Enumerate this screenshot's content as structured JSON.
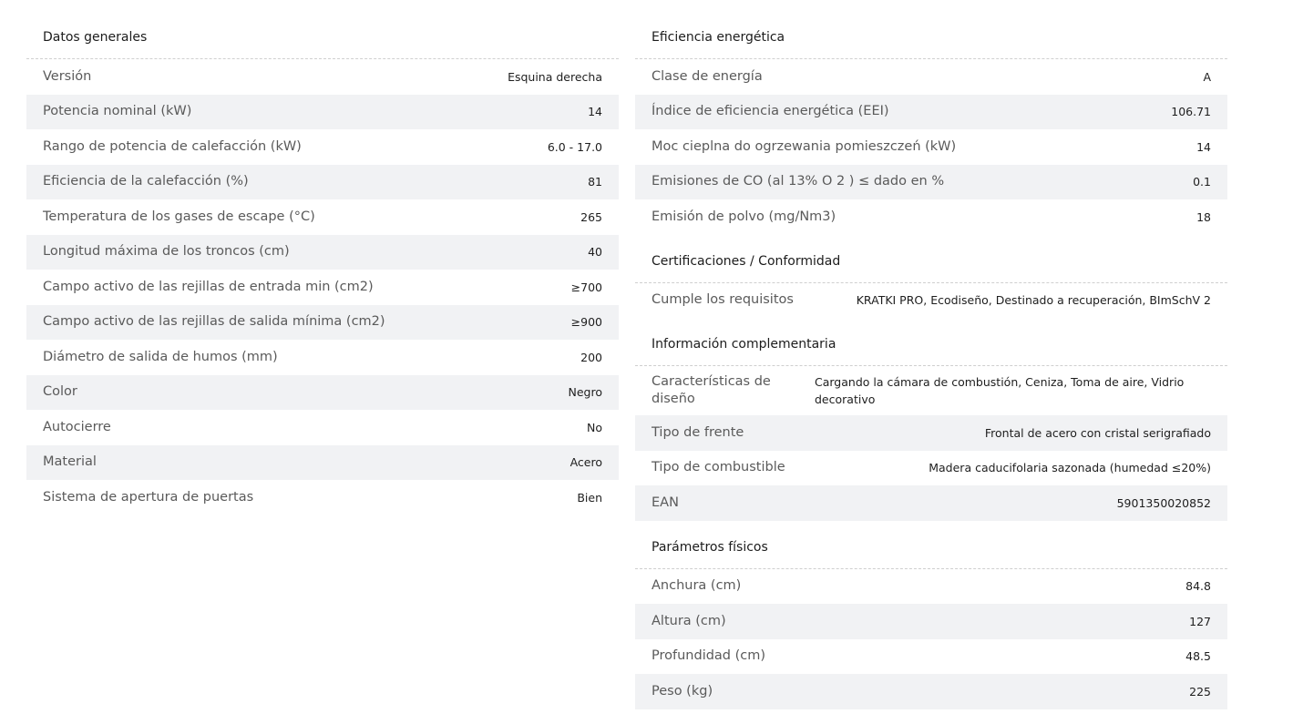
{
  "left": {
    "title": "Datos generales",
    "rows": [
      {
        "label": "Versión",
        "value": "Esquina derecha"
      },
      {
        "label": "Potencia nominal (kW)",
        "value": "14"
      },
      {
        "label": "Rango de potencia de calefacción (kW)",
        "value": "6.0 - 17.0"
      },
      {
        "label": "Eficiencia de la calefacción (%)",
        "value": "81"
      },
      {
        "label": "Temperatura de los gases de escape (°C)",
        "value": "265"
      },
      {
        "label": "Longitud máxima de los troncos (cm)",
        "value": "40"
      },
      {
        "label": "Campo activo de las rejillas de entrada min (cm2)",
        "value": "≥700"
      },
      {
        "label": "Campo activo de las rejillas de salida mínima (cm2)",
        "value": "≥900"
      },
      {
        "label": "Diámetro de salida de humos (mm)",
        "value": "200"
      },
      {
        "label": "Color",
        "value": "Negro"
      },
      {
        "label": "Autocierre",
        "value": "No"
      },
      {
        "label": "Material",
        "value": "Acero"
      },
      {
        "label": "Sistema de apertura de puertas",
        "value": "Bien"
      }
    ]
  },
  "energy": {
    "title": "Eficiencia energética",
    "rows": [
      {
        "label": "Clase de energía",
        "value": "A"
      },
      {
        "label": "Índice de eficiencia energética (EEI)",
        "value": "106.71"
      },
      {
        "label": "Moc cieplna do ogrzewania pomieszczeń (kW)",
        "value": "14"
      },
      {
        "label": "Emisiones de CO (al 13% O 2 ) ≤ dado en %",
        "value": "0.1"
      },
      {
        "label": "Emisión de polvo (mg/Nm3)",
        "value": "18"
      }
    ]
  },
  "certs": {
    "title": "Certificaciones / Conformidad",
    "rows": [
      {
        "label": "Cumple los requisitos",
        "value": "KRATKI PRO, Ecodiseño, Destinado a recuperación, BImSchV 2"
      }
    ]
  },
  "extra": {
    "title": "Información complementaria",
    "design_label": "Características de diseño",
    "design_value": "Cargando la cámara de combustión, Ceniza, Toma de aire, Vidrio decorativo",
    "rows": [
      {
        "label": "Tipo de frente",
        "value": "Frontal de acero con cristal serigrafiado"
      },
      {
        "label": "Tipo de combustible",
        "value": "Madera caducifolaria sazonada (humedad ≤20%)"
      },
      {
        "label": "EAN",
        "value": "5901350020852"
      }
    ]
  },
  "physical": {
    "title": "Parámetros físicos",
    "rows": [
      {
        "label": "Anchura (cm)",
        "value": "84.8"
      },
      {
        "label": "Altura (cm)",
        "value": "127"
      },
      {
        "label": "Profundidad (cm)",
        "value": "48.5"
      },
      {
        "label": "Peso (kg)",
        "value": "225"
      }
    ]
  }
}
